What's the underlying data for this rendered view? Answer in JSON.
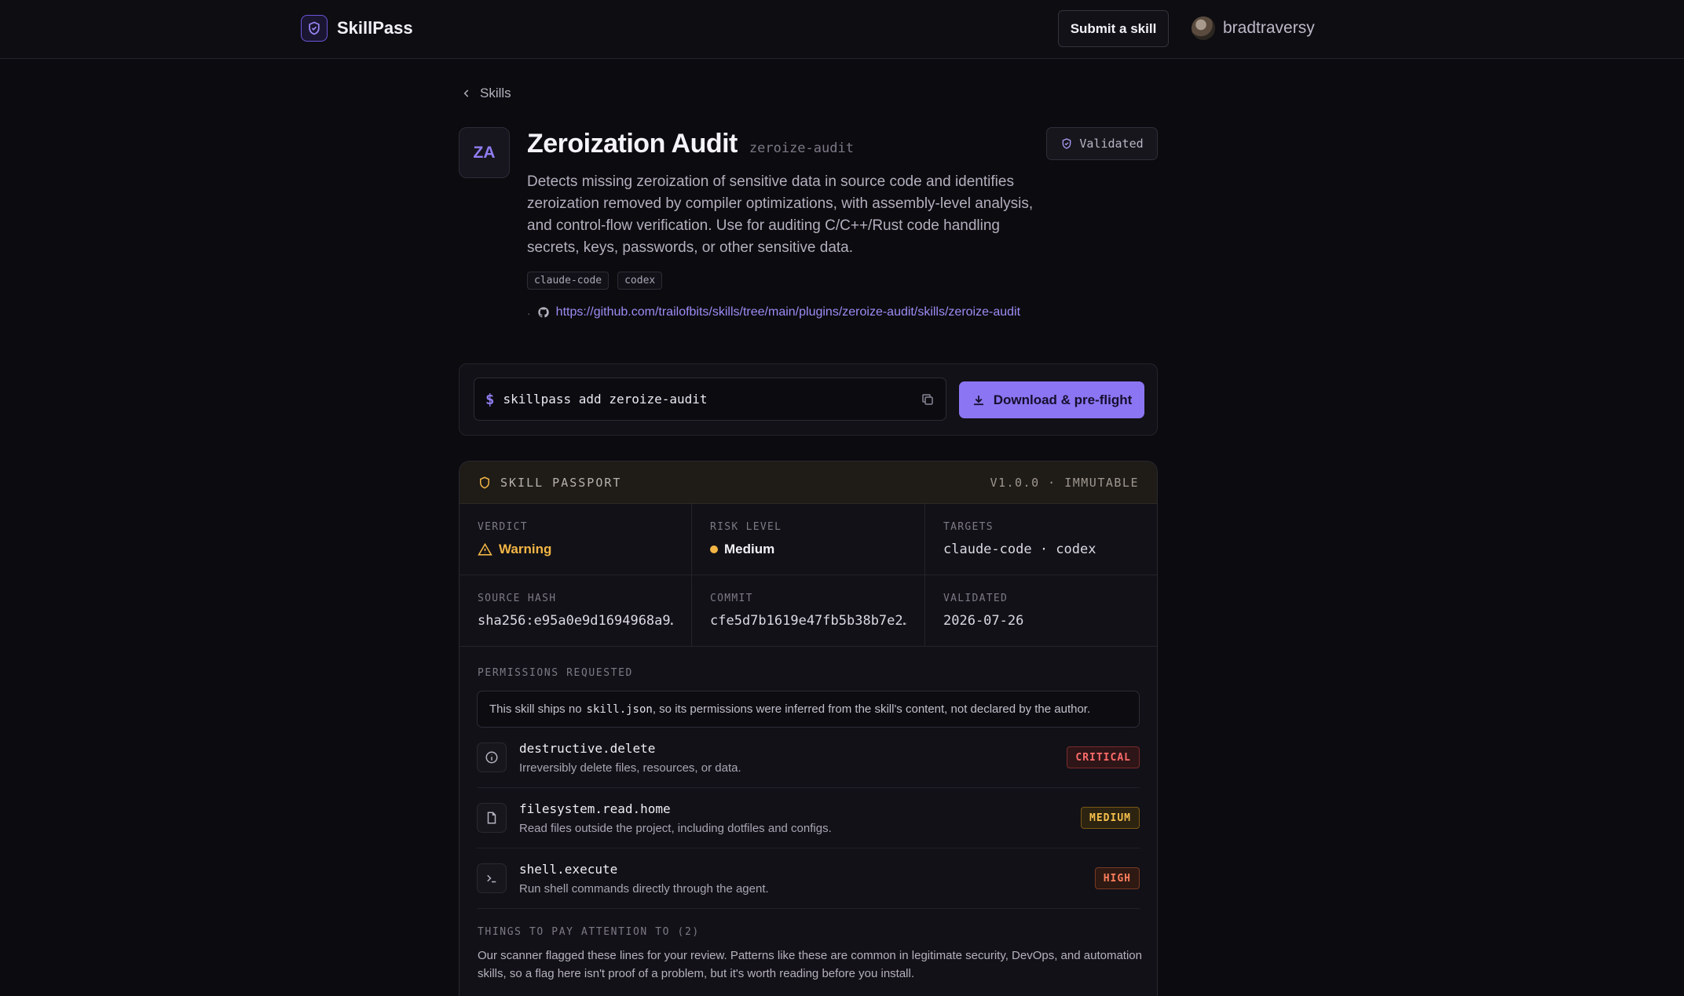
{
  "nav": {
    "brand": "SkillPass",
    "submit_label": "Submit a skill",
    "username": "bradtraversy"
  },
  "breadcrumb": {
    "label": "Skills"
  },
  "skill": {
    "initials": "ZA",
    "title": "Zeroization Audit",
    "slug": "zeroize-audit",
    "status_badge": "Validated",
    "description": "Detects missing zeroization of sensitive data in source code and identifies zeroization removed by compiler optimizations, with assembly-level analysis, and control-flow verification. Use for auditing C/C++/Rust code handling secrets, keys, passwords, or other sensitive data.",
    "tags": [
      "claude-code",
      "codex"
    ],
    "repo_url": "https://github.com/trailofbits/skills/tree/main/plugins/zeroize-audit/skills/zeroize-audit"
  },
  "install": {
    "prompt": "$",
    "command": "skillpass add zeroize-audit",
    "download_label": "Download & pre-flight"
  },
  "passport": {
    "title": "SKILL PASSPORT",
    "version": "V1.0.0 · IMMUTABLE",
    "cells": [
      {
        "label": "VERDICT",
        "value": "Warning"
      },
      {
        "label": "RISK LEVEL",
        "value": "Medium"
      },
      {
        "label": "TARGETS",
        "value": "claude-code · codex"
      },
      {
        "label": "SOURCE HASH",
        "value": "sha256:e95a0e9d1694968a9…"
      },
      {
        "label": "COMMIT",
        "value": "cfe5d7b1619e47fb5b38b7e2…"
      },
      {
        "label": "VALIDATED",
        "value": "2026-07-26"
      }
    ],
    "permissions_label": "PERMISSIONS REQUESTED",
    "notice": {
      "before": "This skill ships no",
      "code": "skill.json",
      "after": ", so its permissions were inferred from the skill's content, not declared by the author."
    },
    "permissions": [
      {
        "name": "destructive.delete",
        "desc": "Irreversibly delete files, resources, or data.",
        "severity": "CRITICAL",
        "icon": "info-icon"
      },
      {
        "name": "filesystem.read.home",
        "desc": "Read files outside the project, including dotfiles and configs.",
        "severity": "MEDIUM",
        "icon": "file-icon"
      },
      {
        "name": "shell.execute",
        "desc": "Run shell commands directly through the agent.",
        "severity": "HIGH",
        "icon": "terminal-icon"
      }
    ],
    "attention_label": "THINGS TO PAY ATTENTION TO (2)",
    "attention_text": "Our scanner flagged these lines for your review. Patterns like these are common in legitimate security, DevOps, and automation skills, so a flag here isn't proof of a problem, but it's worth reading before you install."
  },
  "colors": {
    "accent": "#8c75f3",
    "warning": "#f2b545",
    "critical": "#ff6b6b",
    "high": "#ff7f5c"
  }
}
